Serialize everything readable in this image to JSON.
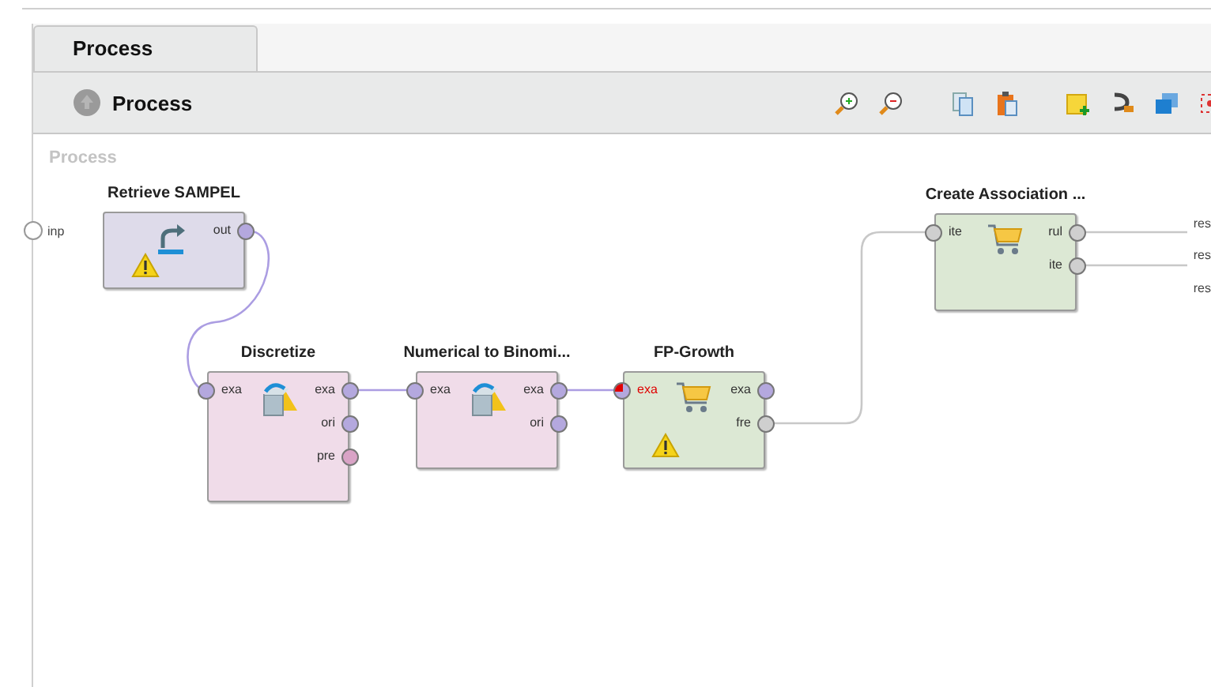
{
  "tabs": [
    {
      "label": "Process",
      "selected": true
    }
  ],
  "toolbar": {
    "title": "Process"
  },
  "canvas": {
    "breadcrumb": "Process",
    "process_inputs": [
      {
        "label": "inp"
      }
    ],
    "process_outputs": [
      {
        "label": "res"
      },
      {
        "label": "res"
      },
      {
        "label": "res"
      }
    ],
    "operators": [
      {
        "name": "Retrieve SAMPEL",
        "kind": "retrieve",
        "color": "#dedbea",
        "warning": true,
        "outputs": [
          {
            "label": "out",
            "color": "#b4a8de",
            "error": false
          }
        ]
      },
      {
        "name": "Discretize",
        "kind": "transform",
        "color": "#f0dce9",
        "warning": false,
        "inputs": [
          {
            "label": "exa",
            "color": "#b4a8de",
            "error": false
          }
        ],
        "outputs": [
          {
            "label": "exa",
            "color": "#b4a8de",
            "error": false
          },
          {
            "label": "ori",
            "color": "#b4a8de",
            "error": false
          },
          {
            "label": "pre",
            "color": "#d9a3c6",
            "error": false
          }
        ]
      },
      {
        "name": "Numerical to Binomi...",
        "kind": "transform",
        "color": "#f0dce9",
        "warning": false,
        "inputs": [
          {
            "label": "exa",
            "color": "#b4a8de",
            "error": false
          }
        ],
        "outputs": [
          {
            "label": "exa",
            "color": "#b4a8de",
            "error": false
          },
          {
            "label": "ori",
            "color": "#b4a8de",
            "error": false
          }
        ]
      },
      {
        "name": "FP-Growth",
        "kind": "cart",
        "color": "#dce8d4",
        "warning": true,
        "inputs": [
          {
            "label": "exa",
            "color": "#b4a8de",
            "error": true
          }
        ],
        "outputs": [
          {
            "label": "exa",
            "color": "#b4a8de",
            "error": false
          },
          {
            "label": "fre",
            "color": "#cfcfcf",
            "error": false
          }
        ]
      },
      {
        "name": "Create Association ...",
        "kind": "cart",
        "color": "#dce8d4",
        "warning": false,
        "inputs": [
          {
            "label": "ite",
            "color": "#cfcfcf",
            "error": false
          }
        ],
        "outputs": [
          {
            "label": "rul",
            "color": "#cfcfcf",
            "error": false
          },
          {
            "label": "ite",
            "color": "#cfcfcf",
            "error": false
          }
        ]
      }
    ]
  }
}
